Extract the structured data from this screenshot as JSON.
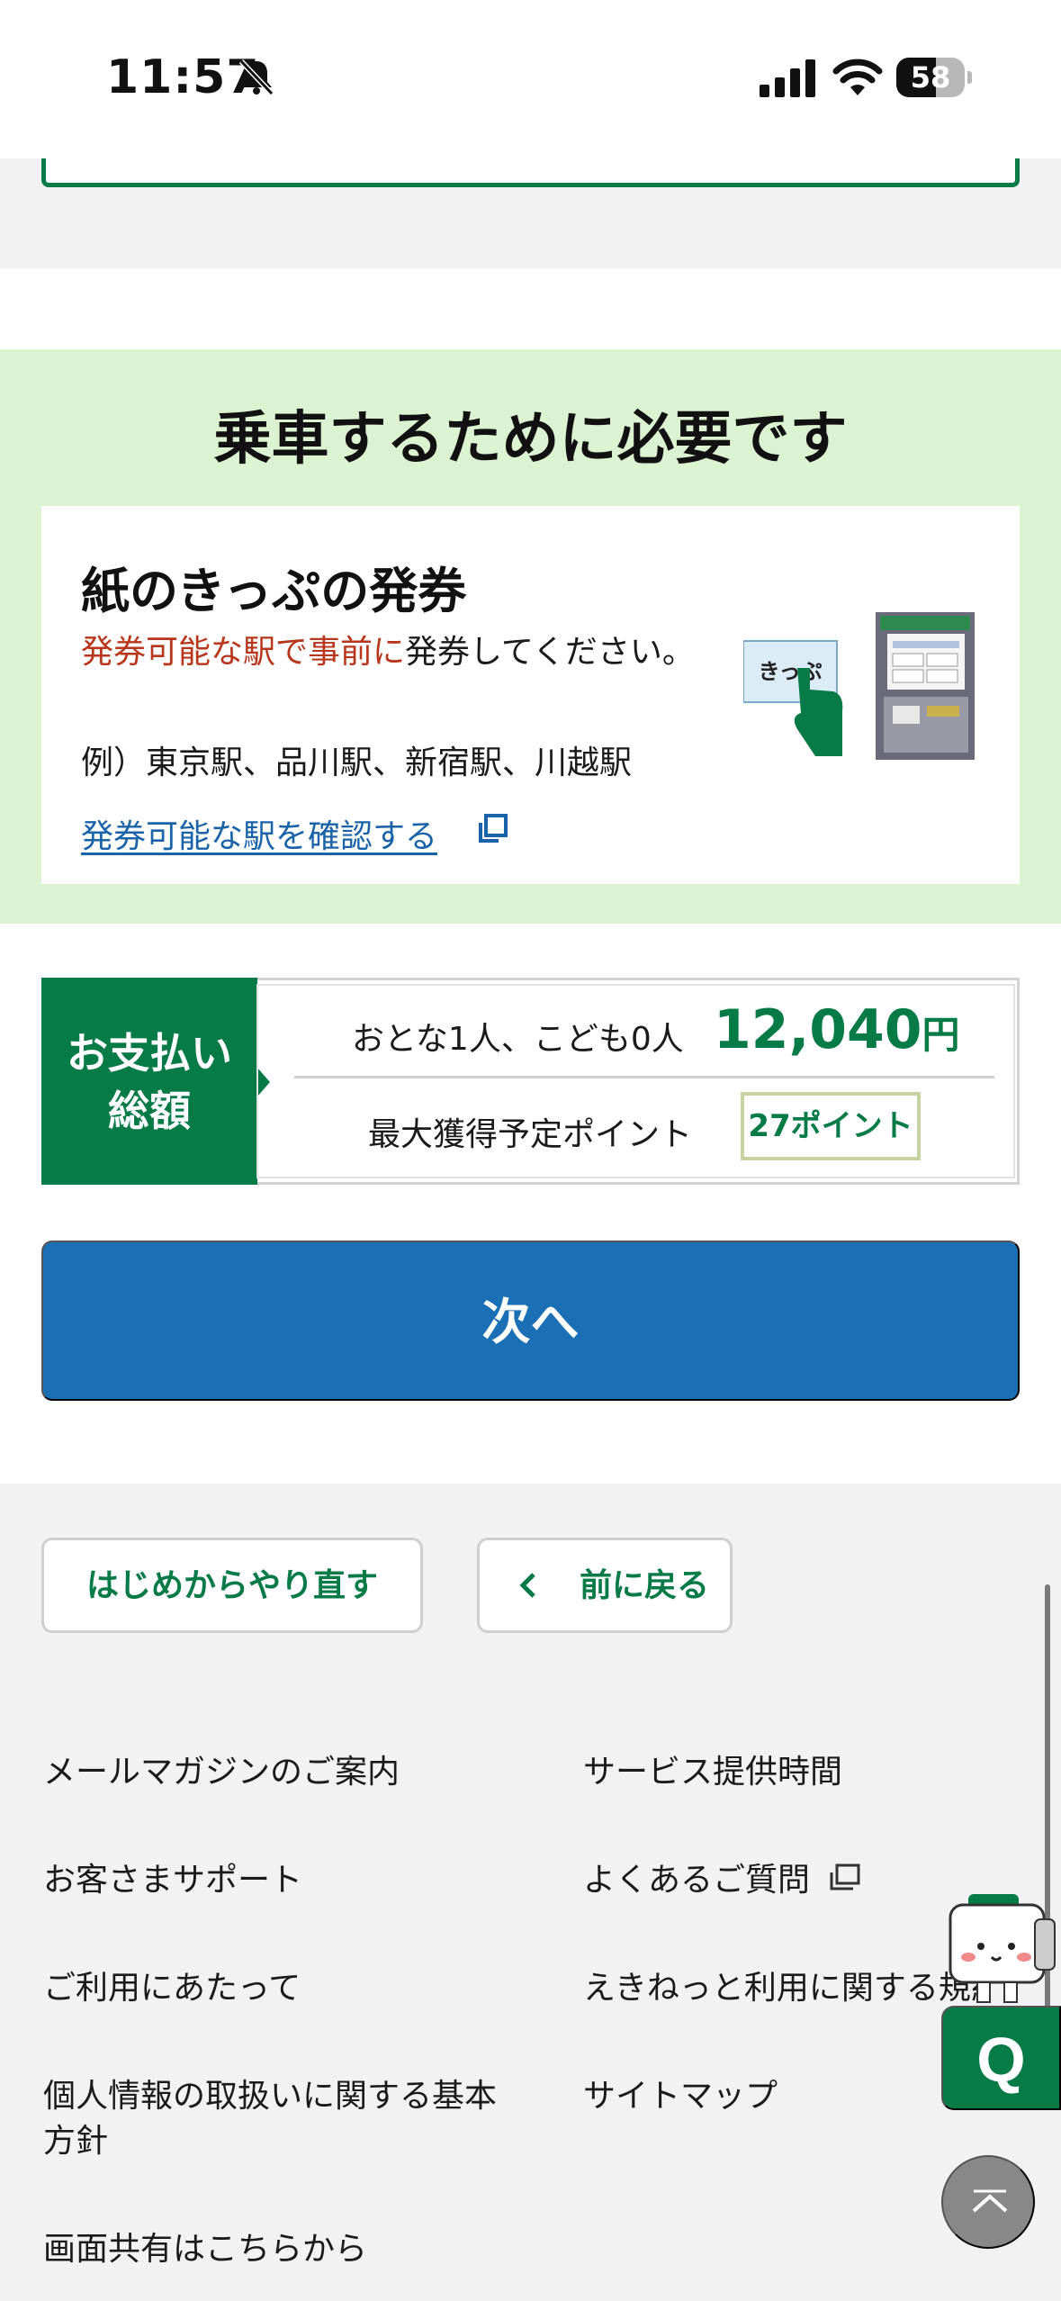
{
  "status_bar": {
    "time": "11:57",
    "battery_level": "58",
    "battery_fraction": 0.58
  },
  "ticket_section": {
    "title": "乗車するために必要です",
    "card_title": "紙のきっぷの発券",
    "desc_highlight": "発券可能な駅で事前に",
    "desc_rest": "発券してください。",
    "example": "例）東京駅、品川駅、新宿駅、川越駅",
    "link": "発券可能な駅を確認する",
    "illustration_label": "きっぷ"
  },
  "payment": {
    "label_line1": "お支払い",
    "label_line2": "総額",
    "passengers": "おとな1人、こども0人",
    "amount": "12,040",
    "currency": "円",
    "points_label": "最大獲得予定ポイント",
    "points": "27ポイント"
  },
  "actions": {
    "next": "次へ",
    "restart": "はじめからやり直す",
    "back": "前に戻る"
  },
  "footer": {
    "mail": "メールマガジンのご案内",
    "hours": "サービス提供時間",
    "support": "お客さまサポート",
    "faq": "よくあるご質問",
    "usage": "ご利用にあたって",
    "terms": "えきねっと利用に関する規約",
    "privacy": "個人情報の取扱いに関する基本方針",
    "sitemap": "サイトマップ",
    "share": "画面共有はこちらから"
  },
  "help": {
    "q_label": "Q"
  },
  "colors": {
    "brand_green": "#067a47",
    "primary_blue": "#1b6fb5",
    "highlight_red": "#b8361b",
    "link_blue": "#1a63a8",
    "section_bg": "#dcf3d2"
  }
}
